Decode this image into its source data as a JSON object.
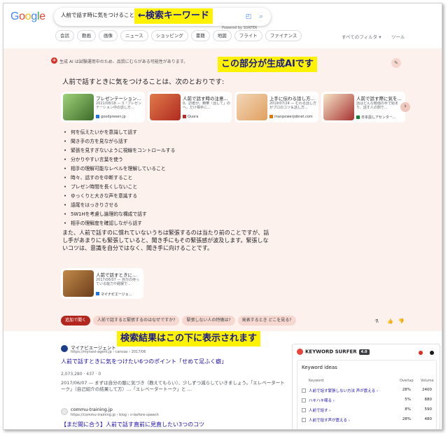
{
  "header": {
    "logo": [
      "G",
      "o",
      "o",
      "g",
      "l",
      "e"
    ],
    "search_value": "人前で話す時に気をつけること",
    "annotation_search": "←検索キーワード",
    "powered_by": "Powered by SURFER",
    "chips": [
      "会話",
      "動画",
      "画像",
      "ニュース",
      "ショッピング",
      "書籍",
      "地図",
      "フライト",
      "ファイナンス"
    ],
    "all_filters": "すべてのフィルタ ▾",
    "tools": "ツール"
  },
  "ai_overview": {
    "warning": "生成 AI は試験運用中のため、品質にむらがある可能性があります。",
    "annotation": "この部分が生成AIです",
    "heading": "人前で話すときに気をつけることは、次のとおりです:",
    "cards": [
      {
        "title": "プレゼンテーション...",
        "snippet": "2021/08/18 — 3「プレゼンテーション中の話し方...",
        "source": "goodpresen.jp",
        "thumb_color": "#3d6b2a"
      },
      {
        "title": "人前で話す時の注意...",
        "snippet": "0。訪者が、精華「話して」のへ、だけ相手に...",
        "source": "Quora",
        "thumb_color": "#b02a20"
      },
      {
        "title": "上手に伝わる話し方...",
        "snippet": "2019/07/24 — むわる話し方がプロのコツ＆話し方...",
        "source": "manpowerjobnet.com",
        "thumb_color": "#e0a060"
      },
      {
        "title": "人前で話す際に気を...",
        "snippet": "話はどんな勉強の手で始まり、話す人の側で...",
        "source": "日本語しアセンター...",
        "thumb_color": "#a83232"
      }
    ],
    "bullets": [
      "何を伝えたいかを意識して話す",
      "聞き手の方を見ながら話す",
      "緊張を見すぎないように視線をコントロールする",
      "分かりやすい言葉を使う",
      "相手の理解可能なレベルを理解していること",
      "時々、話すのを中断すること",
      "プレゼン時間を長くしないこと",
      "ゆっくりと大きな声を意識する",
      "語尾をはっきりさせる",
      "5W1Hを考慮し論理的な構成で話す",
      "相手の理解度を確認しながら話す"
    ],
    "summary": "また、人前で話すのに慣れていないうちは緊張するのは当たり前のことですが、話し手があまりにも緊張していると、聞き手にもその緊張感が波及します。緊張しないコツは、意識を自分ではなく、聞き手に向けることです。",
    "ref_card": {
      "title": "人前で話すときに...",
      "snippet": "2017/06/07 — 自分の持っている能力や経験で...",
      "source": "マイナビエージェ..."
    },
    "followups": [
      "追加で聞く",
      "人前で話すると緊張するのはなぜですか?",
      "緊張しない人の特徴は?",
      "発表するとき どこを見る?"
    ]
  },
  "annotation_results": "検索結果はこの下に表示されます",
  "results": [
    {
      "site": "マイナビエージェント",
      "url": "https://mynavi-agent.jp › canvas › 2017/06",
      "title": "人前で話すときに気をつけたい6つのポイント「せめて足ふく癖」",
      "meta": "2,073,280 · 437 · 0",
      "snippet": "2017/06/07 — まずは自分の服に気づき（教えてもらい）、少しずつ減らしていきましょう。「エレベータートーク」（自己紹介の結果して方）…「エレベータートーク」と ..."
    },
    {
      "site": "commu-training.jp",
      "url": "https://commu-training.jp › blog › n-before-speech",
      "title": "【まだ間に合う】人前で話す直前に見直したい3つのコツ"
    }
  ],
  "keyword_surfer": {
    "name": "KEYWORD SURFER",
    "version": "4.0",
    "ideas_title": "Keyword ideas",
    "columns": [
      "Keyword",
      "Overlap",
      "Volume"
    ],
    "rows": [
      {
        "keyword": "人前で話す緊張しない方法 声が震える ›",
        "overlap": "28%",
        "volume": "2400"
      },
      {
        "keyword": "ハキハキ喋る ›",
        "overlap": "5%",
        "volume": "880"
      },
      {
        "keyword": "人前で話す ›",
        "overlap": "8%",
        "volume": "590"
      },
      {
        "keyword": "人前で話す声が震える ›",
        "overlap": "28%",
        "volume": "480"
      }
    ]
  }
}
